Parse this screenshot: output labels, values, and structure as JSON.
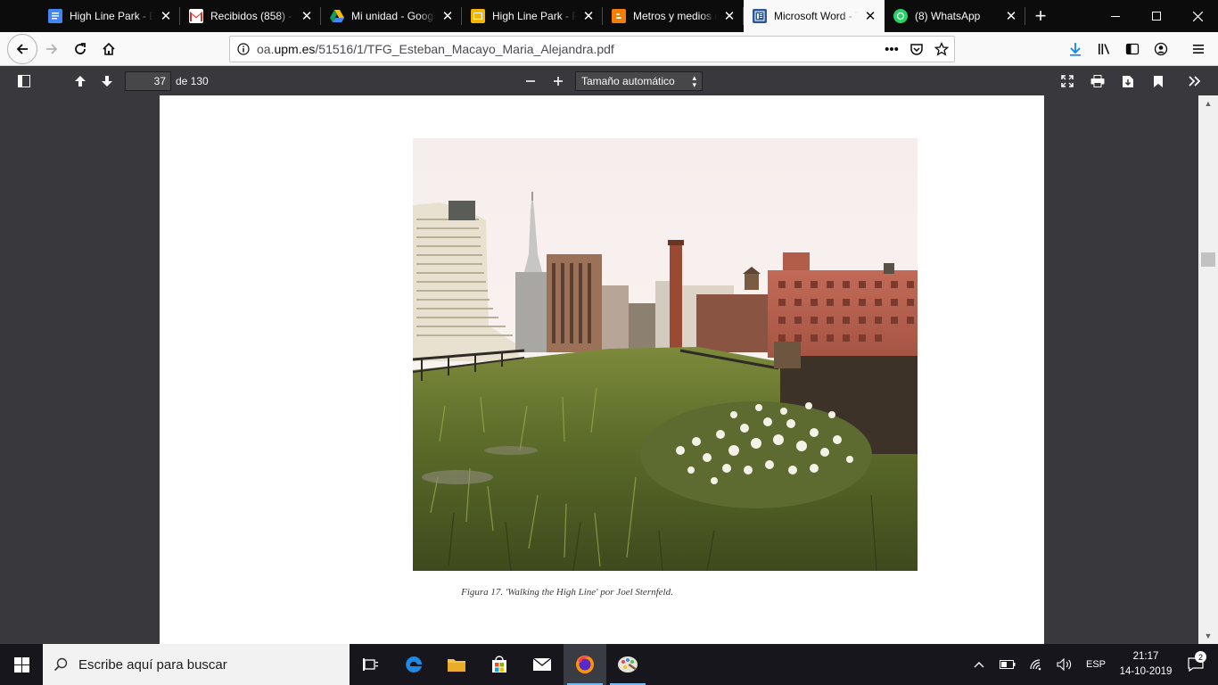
{
  "browser": {
    "tabs": [
      {
        "title": "High Line Park - D",
        "favicon_color": "#4285f4",
        "favicon": "docs-icon",
        "active": false
      },
      {
        "title": "Recibidos (858) - n",
        "favicon_color": "#ffffff",
        "favicon": "gmail-icon",
        "active": false
      },
      {
        "title": "Mi unidad - Googl",
        "favicon_color": "#ffffff",
        "favicon": "drive-icon",
        "active": false
      },
      {
        "title": "High Line Park - P",
        "favicon_color": "#f4b400",
        "favicon": "slides-icon",
        "active": false
      },
      {
        "title": "Metros y medios d",
        "favicon_color": "#f57d00",
        "favicon": "blogger-icon",
        "active": false
      },
      {
        "title": "Microsoft Word - T",
        "favicon_color": "#2b579a",
        "favicon": "document-icon",
        "active": true
      },
      {
        "title": "(8) WhatsApp",
        "favicon_color": "#25d366",
        "favicon": "whatsapp-icon",
        "active": false
      }
    ],
    "url_prefix": "oa.",
    "url_host": "upm.es",
    "url_path": "/51516/1/TFG_Esteban_Macayo_Maria_Alejandra.pdf"
  },
  "pdf_toolbar": {
    "page_number": "37",
    "page_total": "de 130",
    "zoom_label": "Tamaño automático"
  },
  "document": {
    "caption": "Figura 17. 'Walking the High Line' por Joel Sternfeld."
  },
  "taskbar": {
    "search_placeholder": "Escribe aquí para buscar",
    "language": "ESP",
    "time": "21:17",
    "date": "14-10-2019",
    "notification_count": "2"
  },
  "colors": {
    "tab_strip": "#0c0c0d",
    "pdf_toolbar": "#38383d",
    "accent_blue": "#0a84ff"
  }
}
